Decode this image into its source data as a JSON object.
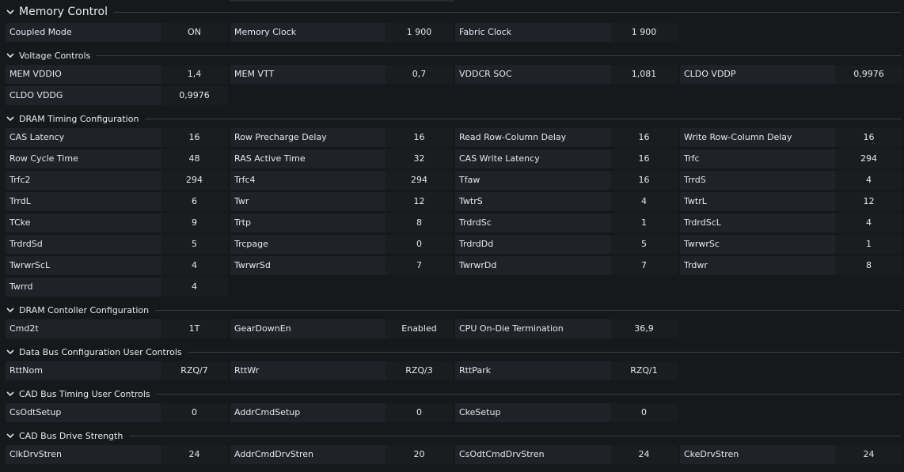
{
  "sections": [
    {
      "title": "Memory Control",
      "rows": [
        [
          [
            "Coupled Mode",
            "ON"
          ],
          [
            "Memory Clock",
            "1 900"
          ],
          [
            "Fabric Clock",
            "1 900"
          ]
        ]
      ]
    },
    {
      "title": "Voltage Controls",
      "rows": [
        [
          [
            "MEM VDDIO",
            "1,4"
          ],
          [
            "MEM VTT",
            "0,7"
          ],
          [
            "VDDCR SOC",
            "1,081"
          ],
          [
            "CLDO VDDP",
            "0,9976"
          ]
        ],
        [
          [
            "CLDO VDDG",
            "0,9976"
          ]
        ]
      ]
    },
    {
      "title": "DRAM Timing Configuration",
      "rows": [
        [
          [
            "CAS Latency",
            "16"
          ],
          [
            "Row Precharge Delay",
            "16"
          ],
          [
            "Read Row-Column Delay",
            "16"
          ],
          [
            "Write Row-Column Delay",
            "16"
          ]
        ],
        [
          [
            "Row Cycle Time",
            "48"
          ],
          [
            "RAS Active Time",
            "32"
          ],
          [
            "CAS Write Latency",
            "16"
          ],
          [
            "Trfc",
            "294"
          ]
        ],
        [
          [
            "Trfc2",
            "294"
          ],
          [
            "Trfc4",
            "294"
          ],
          [
            "Tfaw",
            "16"
          ],
          [
            "TrrdS",
            "4"
          ]
        ],
        [
          [
            "TrrdL",
            "6"
          ],
          [
            "Twr",
            "12"
          ],
          [
            "TwtrS",
            "4"
          ],
          [
            "TwtrL",
            "12"
          ]
        ],
        [
          [
            "TCke",
            "9"
          ],
          [
            "Trtp",
            "8"
          ],
          [
            "TrdrdSc",
            "1"
          ],
          [
            "TrdrdScL",
            "4"
          ]
        ],
        [
          [
            "TrdrdSd",
            "5"
          ],
          [
            "Trcpage",
            "0"
          ],
          [
            "TrdrdDd",
            "5"
          ],
          [
            "TwrwrSc",
            "1"
          ]
        ],
        [
          [
            "TwrwrScL",
            "4"
          ],
          [
            "TwrwrSd",
            "7"
          ],
          [
            "TwrwrDd",
            "7"
          ],
          [
            "Trdwr",
            "8"
          ]
        ],
        [
          [
            "Twrrd",
            "4"
          ]
        ]
      ]
    },
    {
      "title": "DRAM Contoller Configuration",
      "rows": [
        [
          [
            "Cmd2t",
            "1T"
          ],
          [
            "GearDownEn",
            "Enabled"
          ],
          [
            "CPU On-Die Termination",
            "36,9"
          ]
        ]
      ]
    },
    {
      "title": "Data Bus Configuration User Controls",
      "rows": [
        [
          [
            "RttNom",
            "RZQ/7"
          ],
          [
            "RttWr",
            "RZQ/3"
          ],
          [
            "RttPark",
            "RZQ/1"
          ]
        ]
      ]
    },
    {
      "title": "CAD Bus Timing User Controls",
      "rows": [
        [
          [
            "CsOdtSetup",
            "0"
          ],
          [
            "AddrCmdSetup",
            "0"
          ],
          [
            "CkeSetup",
            "0"
          ]
        ]
      ]
    },
    {
      "title": "CAD Bus Drive Strength",
      "rows": [
        [
          [
            "ClkDrvStren",
            "24"
          ],
          [
            "AddrCmdDrvStren",
            "20"
          ],
          [
            "CsOdtCmdDrvStren",
            "24"
          ],
          [
            "CkeDrvStren",
            "24"
          ]
        ]
      ]
    }
  ],
  "icons": {
    "collapse": "chevron-down-icon"
  },
  "colors": {
    "background": "#16191c",
    "label_cell": "#1f2327",
    "value_cell": "#1a1d20",
    "divider": "#3a4046",
    "text": "#e6e8ea"
  }
}
